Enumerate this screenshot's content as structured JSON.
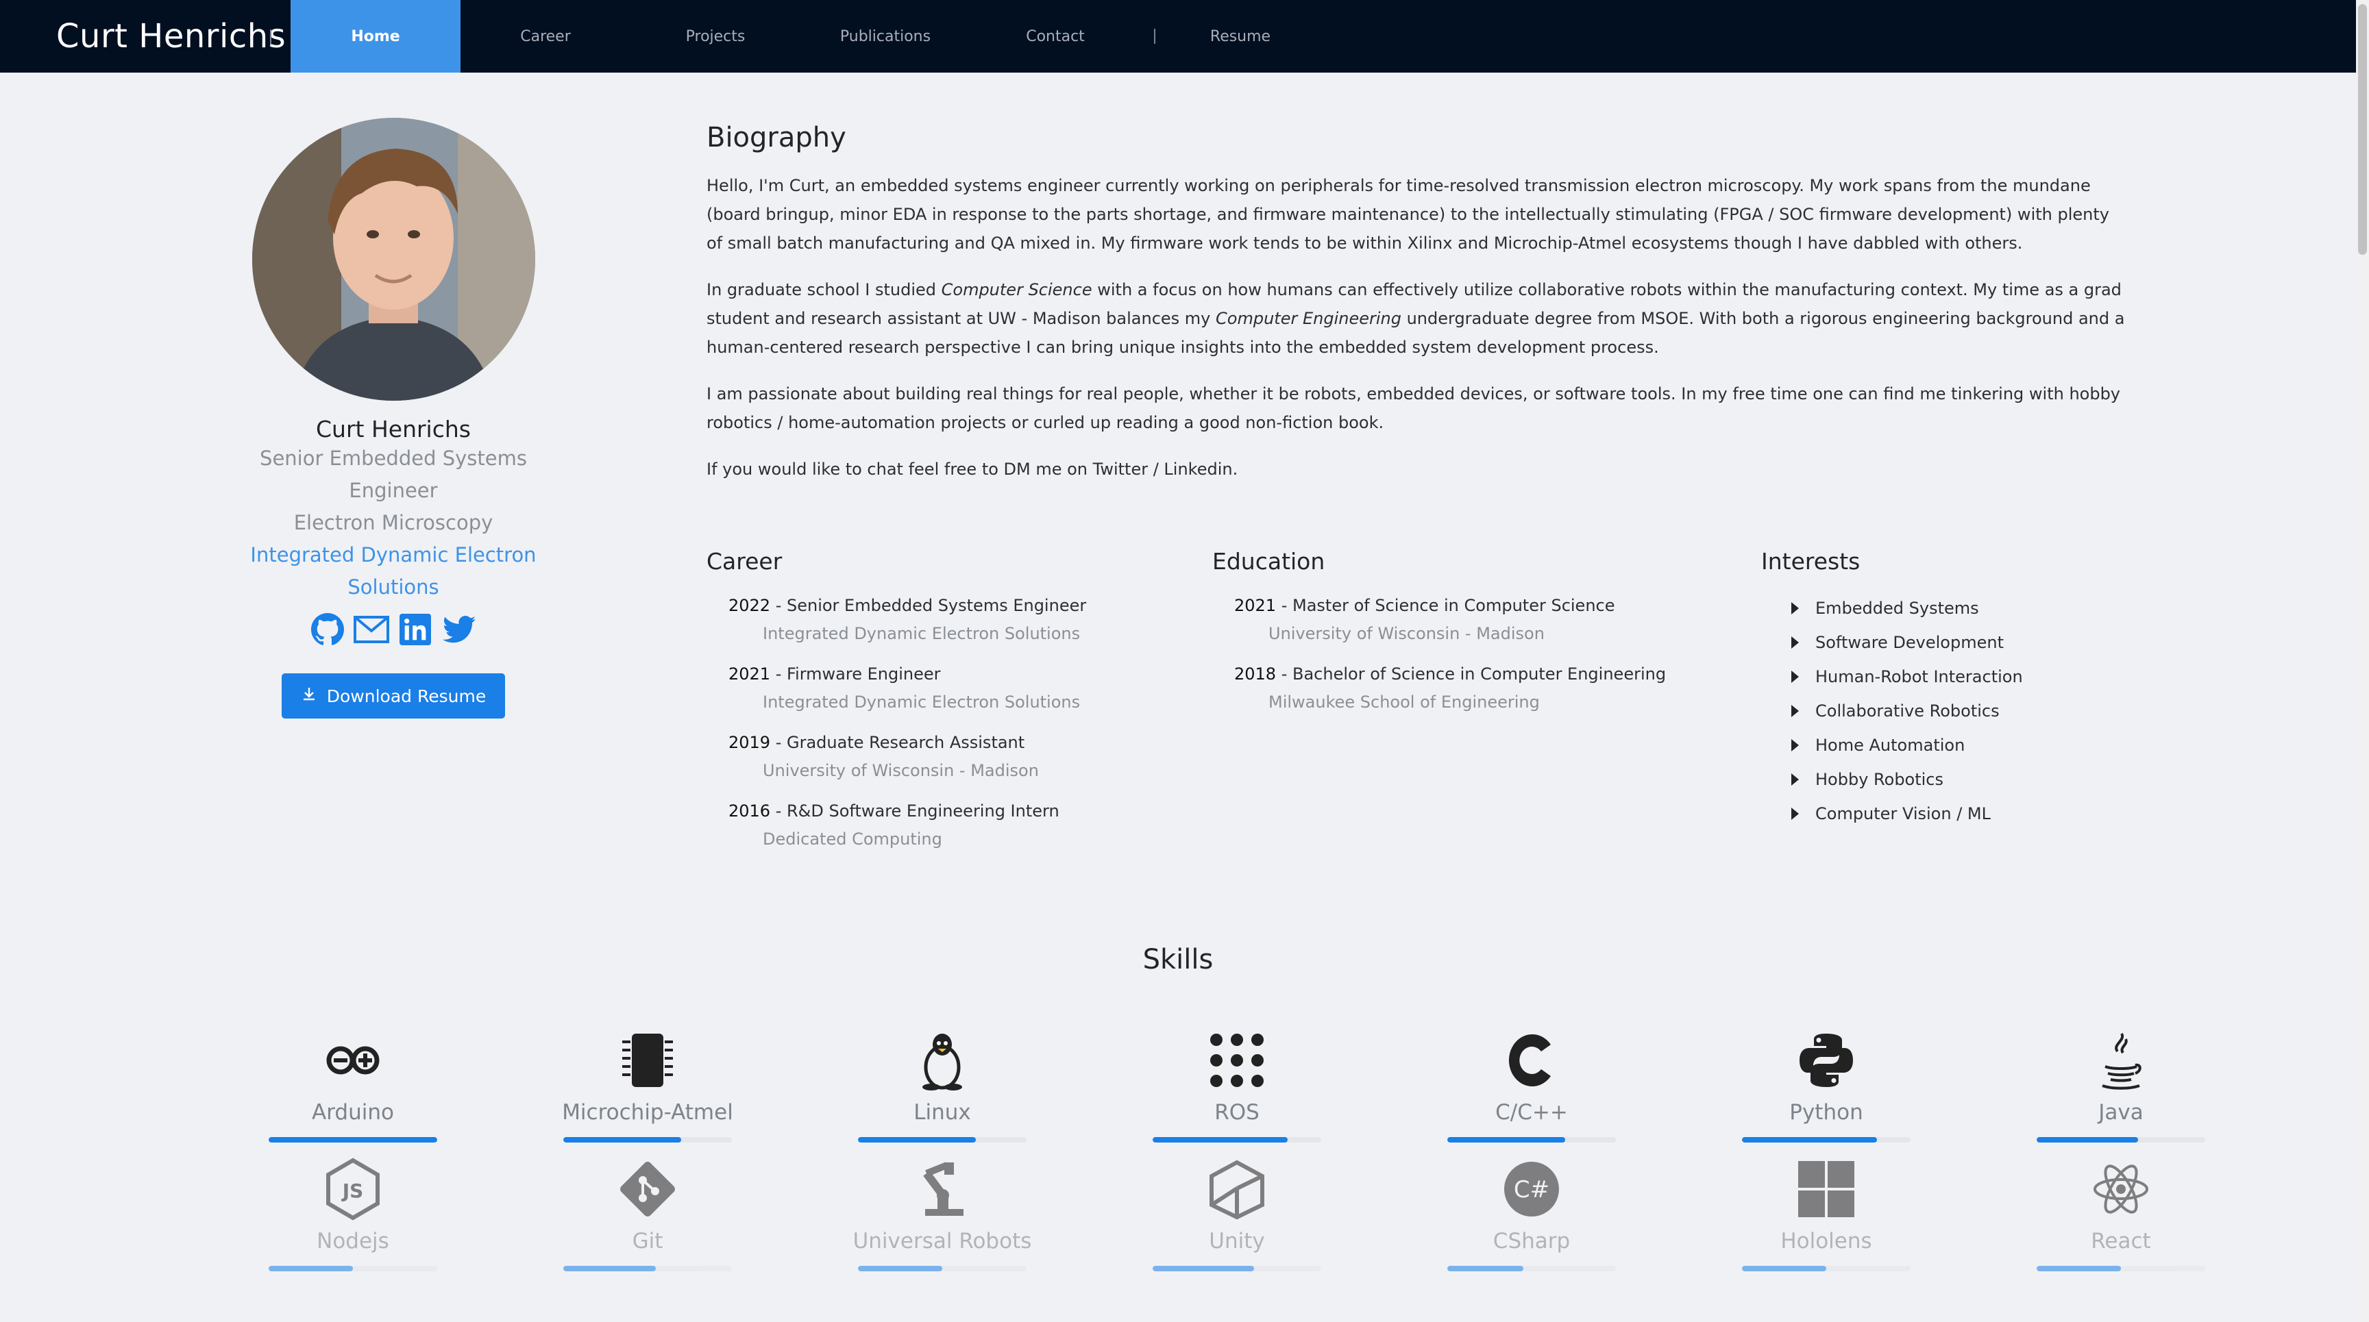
{
  "nav": {
    "brand": "Curt Henrichs",
    "items": [
      {
        "label": "Home",
        "active": true
      },
      {
        "label": "Career"
      },
      {
        "label": "Projects"
      },
      {
        "label": "Publications"
      },
      {
        "label": "Contact"
      }
    ],
    "resume": "Resume"
  },
  "profile": {
    "name": "Curt Henrichs",
    "title_line1": "Senior Embedded Systems",
    "title_line2": "Engineer",
    "field": "Electron Microscopy",
    "company_line1": "Integrated Dynamic Electron",
    "company_line2": "Solutions",
    "socials": [
      "github-icon",
      "mail-icon",
      "linkedin-icon",
      "twitter-icon"
    ],
    "download_label": "Download Resume"
  },
  "bio": {
    "heading": "Biography",
    "p1": "Hello, I'm Curt, an embedded systems engineer currently working on peripherals for time-resolved transmission electron microscopy. My work spans from the mundane (board bringup, minor EDA in response to the parts shortage, and firmware maintenance) to the intellectually stimulating (FPGA / SOC firmware development) with plenty of small batch manufacturing and QA mixed in. My firmware work tends to be within Xilinx and Microchip-Atmel ecosystems though I have dabbled with others.",
    "p2a": "In graduate school I studied ",
    "p2b": "Computer Science",
    "p2c": " with a focus on how humans can effectively utilize collaborative robots within the manufacturing context. My time as a grad student and research assistant at UW - Madison balances my ",
    "p2d": "Computer Engineering",
    "p2e": " undergraduate degree from MSOE. With both a rigorous engineering background and a human-centered research perspective I can bring unique insights into the embedded system development process.",
    "p3": "I am passionate about building real things for real people, whether it be robots, embedded devices, or software tools. In my free time one can find me tinkering with hobby robotics / home-automation projects or curled up reading a good non-fiction book.",
    "p4": "If you would like to chat feel free to DM me on Twitter / Linkedin."
  },
  "career": {
    "heading": "Career",
    "entries": [
      {
        "year": "2022",
        "role": " - Senior Embedded Systems Engineer",
        "org": "Integrated Dynamic Electron Solutions"
      },
      {
        "year": "2021",
        "role": " - Firmware Engineer",
        "org": "Integrated Dynamic Electron Solutions"
      },
      {
        "year": "2019",
        "role": " - Graduate Research Assistant",
        "org": "University of Wisconsin - Madison"
      },
      {
        "year": "2016",
        "role": " - R&D Software Engineering Intern",
        "org": "Dedicated Computing"
      }
    ]
  },
  "education": {
    "heading": "Education",
    "entries": [
      {
        "year": "2021",
        "degree": " - Master of Science in Computer Science",
        "school": "University of Wisconsin - Madison"
      },
      {
        "year": "2018",
        "degree": " - Bachelor of Science in Computer Engineering",
        "school": "Milwaukee School of Engineering"
      }
    ]
  },
  "interests": {
    "heading": "Interests",
    "items": [
      "Embedded Systems",
      "Software Development",
      "Human-Robot Interaction",
      "Collaborative Robotics",
      "Home Automation",
      "Hobby Robotics",
      "Computer Vision / ML"
    ]
  },
  "skills": {
    "heading": "Skills",
    "items": [
      {
        "name": "Arduino",
        "icon": "arduino-icon",
        "level": 1.0
      },
      {
        "name": "Microchip-Atmel",
        "icon": "chip-icon",
        "level": 0.7
      },
      {
        "name": "Linux",
        "icon": "linux-icon",
        "level": 0.7
      },
      {
        "name": "ROS",
        "icon": "ros-icon",
        "level": 0.8
      },
      {
        "name": "C/C++",
        "icon": "c-icon",
        "level": 0.7
      },
      {
        "name": "Python",
        "icon": "python-icon",
        "level": 0.8
      },
      {
        "name": "Java",
        "icon": "java-icon",
        "level": 0.6
      },
      {
        "name": "Nodejs",
        "icon": "nodejs-icon",
        "level": 0.5
      },
      {
        "name": "Git",
        "icon": "git-icon",
        "level": 0.55
      },
      {
        "name": "Universal Robots",
        "icon": "robot-arm-icon",
        "level": 0.5
      },
      {
        "name": "Unity",
        "icon": "unity-icon",
        "level": 0.6
      },
      {
        "name": "CSharp",
        "icon": "csharp-icon",
        "level": 0.45
      },
      {
        "name": "Hololens",
        "icon": "windows-icon",
        "level": 0.5
      },
      {
        "name": "React",
        "icon": "react-icon",
        "level": 0.5
      }
    ]
  }
}
